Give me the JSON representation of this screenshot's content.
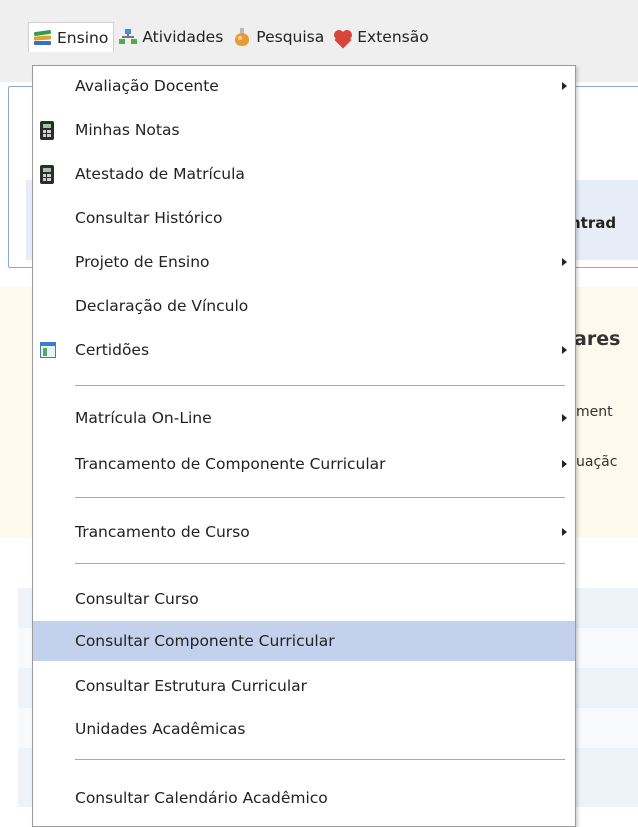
{
  "menubar": {
    "items": [
      {
        "label": "Ensino",
        "icon": "books-icon"
      },
      {
        "label": "Atividades",
        "icon": "network-icon"
      },
      {
        "label": "Pesquisa",
        "icon": "flask-icon"
      },
      {
        "label": "Extensão",
        "icon": "heart-icon"
      }
    ]
  },
  "background": {
    "entrad": "ntrad",
    "ares": "ares",
    "ment": "ment",
    "uacao": "uaçãc"
  },
  "dropdown": {
    "items": [
      {
        "label": "Avaliação Docente",
        "submenu": true,
        "icon": null
      },
      {
        "label": "Minhas Notas",
        "submenu": false,
        "icon": "calculator-icon"
      },
      {
        "label": "Atestado de Matrícula",
        "submenu": false,
        "icon": "calculator-icon"
      },
      {
        "label": "Consultar Histórico",
        "submenu": false,
        "icon": null
      },
      {
        "label": "Projeto de Ensino",
        "submenu": true,
        "icon": null
      },
      {
        "label": "Declaração de Vínculo",
        "submenu": false,
        "icon": null
      },
      {
        "label": "Certidões",
        "submenu": true,
        "icon": "certificate-icon"
      },
      {
        "label": "Matrícula On-Line",
        "submenu": true,
        "icon": null
      },
      {
        "label": "Trancamento de Componente Curricular",
        "submenu": true,
        "icon": null
      },
      {
        "label": "Trancamento de Curso",
        "submenu": true,
        "icon": null
      },
      {
        "label": "Consultar Curso",
        "submenu": false,
        "icon": null
      },
      {
        "label": "Consultar Componente Curricular",
        "submenu": false,
        "icon": null,
        "highlighted": true
      },
      {
        "label": "Consultar Estrutura Curricular",
        "submenu": false,
        "icon": null
      },
      {
        "label": "Unidades Acadêmicas",
        "submenu": false,
        "icon": null
      },
      {
        "label": "Consultar Calendário Acadêmico",
        "submenu": false,
        "icon": null
      }
    ]
  }
}
